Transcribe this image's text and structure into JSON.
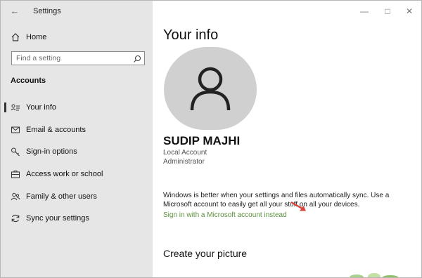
{
  "window": {
    "title": "Settings"
  },
  "sidebar": {
    "home_label": "Home",
    "search_placeholder": "Find a setting",
    "section_title": "Accounts",
    "items": [
      {
        "label": "Your info",
        "icon": "person-card-icon"
      },
      {
        "label": "Email & accounts",
        "icon": "mail-icon"
      },
      {
        "label": "Sign-in options",
        "icon": "key-icon"
      },
      {
        "label": "Access work or school",
        "icon": "briefcase-icon"
      },
      {
        "label": "Family & other users",
        "icon": "people-icon"
      },
      {
        "label": "Sync your settings",
        "icon": "sync-icon"
      }
    ]
  },
  "main": {
    "title": "Your info",
    "user_name": "SUDIP MAJHI",
    "account_type": "Local Account",
    "role": "Administrator",
    "sync_text": "Windows is better when your settings and files automatically sync. Use a Microsoft account to easily get all your stuff on all your devices.",
    "ms_link": "Sign in with a Microsoft account instead",
    "create_picture_title": "Create your picture"
  },
  "colors": {
    "sidebar_bg": "#e6e6e6",
    "link_green": "#5a8f3a",
    "arrow_red": "#d9453c"
  }
}
